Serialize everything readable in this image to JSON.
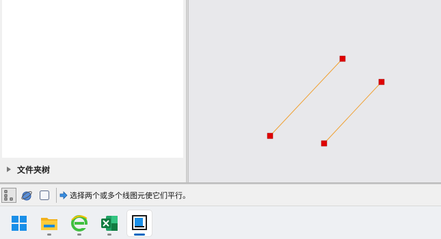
{
  "sidebar": {
    "folder_tree_label": "文件夹树"
  },
  "statusbar": {
    "prompt_text": "选择两个或多个线图元使它们平行。"
  },
  "taskbar": {
    "items": [
      {
        "name": "start",
        "icon": "windows-logo-icon"
      },
      {
        "name": "file-explorer",
        "icon": "folder-icon"
      },
      {
        "name": "browser",
        "icon": "browser-e-icon"
      },
      {
        "name": "excel",
        "icon": "excel-icon"
      },
      {
        "name": "cad-app",
        "icon": "app-window-icon"
      }
    ]
  },
  "colors": {
    "line": "#f0a030",
    "endpoint": "#e00000",
    "canvas_bg": "#e8e8eb",
    "accent": "#0067c0"
  }
}
